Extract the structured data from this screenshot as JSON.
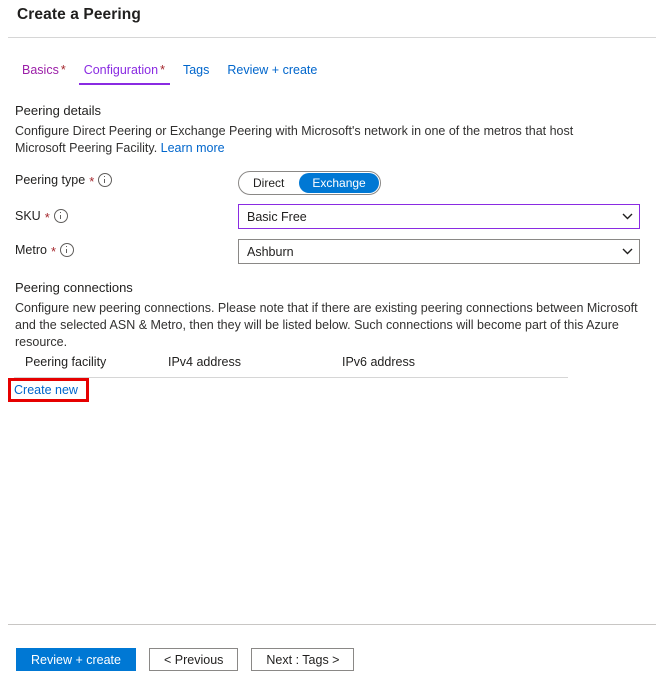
{
  "header": {
    "title": "Create a Peering"
  },
  "tabs": [
    {
      "label": "Basics",
      "required": "*",
      "state": "visited"
    },
    {
      "label": "Configuration",
      "required": "*",
      "state": "active"
    },
    {
      "label": "Tags",
      "required": "",
      "state": "normal"
    },
    {
      "label": "Review + create",
      "required": "",
      "state": "normal"
    }
  ],
  "peering_details": {
    "title": "Peering details",
    "description": "Configure Direct Peering or Exchange Peering with Microsoft's network in one of the metros that host Microsoft Peering Facility.",
    "learn_more": "Learn more"
  },
  "fields": {
    "peering_type": {
      "label": "Peering type",
      "required": "*",
      "info_icon": "info-circle-icon",
      "options": [
        "Direct",
        "Exchange"
      ],
      "selected": "Exchange"
    },
    "sku": {
      "label": "SKU",
      "required": "*",
      "info_icon": "info-circle-icon",
      "value": "Basic Free",
      "chevron_icon": "chevron-down-icon",
      "focused": true
    },
    "metro": {
      "label": "Metro",
      "required": "*",
      "info_icon": "info-circle-icon",
      "value": "Ashburn",
      "chevron_icon": "chevron-down-icon",
      "focused": false
    }
  },
  "peering_connections": {
    "title": "Peering connections",
    "description": "Configure new peering connections. Please note that if there are existing peering connections between Microsoft and the selected ASN & Metro, then they will be listed below. Such connections will become part of this Azure resource.",
    "columns": [
      "Peering facility",
      "IPv4 address",
      "IPv6 address"
    ],
    "rows": [],
    "create_new": "Create new"
  },
  "footer": {
    "review_create": "Review + create",
    "previous": "< Previous",
    "next": "Next : Tags >"
  },
  "colors": {
    "accent_blue": "#0078d4",
    "link_blue": "#0066cc",
    "tab_active_purple": "#8a2be2",
    "tab_visited_purple": "#9b1fa8",
    "required_red": "#a4262c",
    "highlight_red": "#e60000"
  }
}
